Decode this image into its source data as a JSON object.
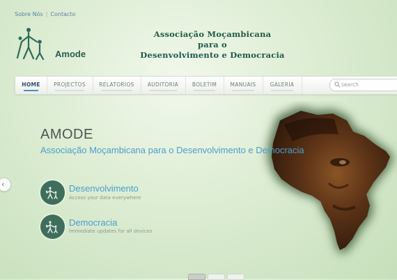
{
  "toplinks": {
    "about": "Sobre Nós",
    "contact": "Contacto"
  },
  "logo": {
    "text": "Amode"
  },
  "header": {
    "line1": "Associação Moçambicana",
    "line2": "para o",
    "line3": "Desenvolvimento e Democracia"
  },
  "nav": {
    "items": [
      {
        "label": "HOME"
      },
      {
        "label": "PROJECTOS"
      },
      {
        "label": "RELATORIOS"
      },
      {
        "label": "AUDITORIA"
      },
      {
        "label": "BOLETIM"
      },
      {
        "label": "MANUAIS"
      },
      {
        "label": "GALERIA"
      }
    ],
    "active": "HOME"
  },
  "search": {
    "placeholder": "search"
  },
  "hero": {
    "title": "AMODE",
    "subtitle": "Associação Moçambicana para o Desenvolvimento e Democracia"
  },
  "features": [
    {
      "title": "Desenvolvimento",
      "desc": "Access your data everywhere",
      "icon": "people-icon"
    },
    {
      "title": "Democracia",
      "desc": "Immediate updates for all devices",
      "icon": "people-icon"
    }
  ],
  "slider": {
    "dots": 3,
    "active_dot": 1
  },
  "colors": {
    "accent": "#4a9fcd",
    "brand_green": "#1f5a45",
    "feature_icon_bg": "#3f6e5c"
  }
}
